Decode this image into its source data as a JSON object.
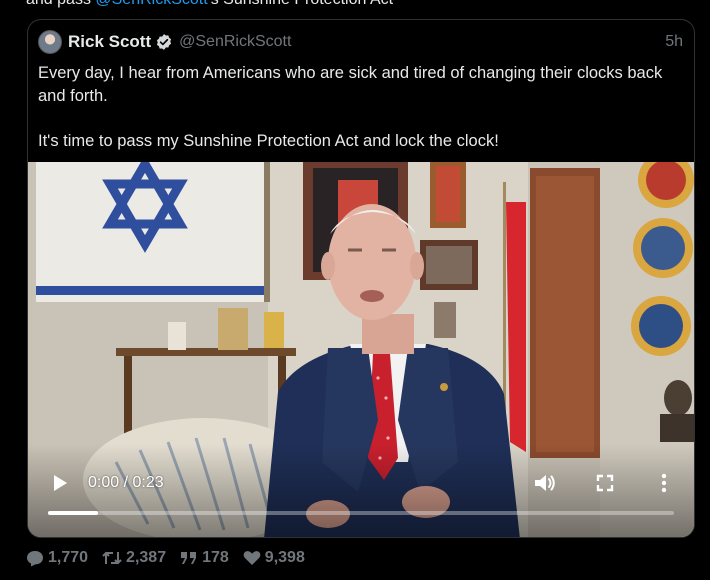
{
  "context_line": {
    "prefix": "and pass ",
    "mention": "@SenRickScott",
    "suffix": "'s Sunshine Protection Act"
  },
  "quoted_tweet": {
    "author_name": "Rick Scott",
    "handle": "@SenRickScott",
    "time": "5h",
    "verified_icon": "verified-badge-icon",
    "text_paragraphs": [
      "Every day, I hear from Americans who are sick and tired of changing their clocks back and forth.",
      "It's time to pass my Sunshine Protection Act and lock the clock!"
    ]
  },
  "video_player": {
    "time_display": "0:00 / 0:23",
    "progress_fraction": 0.08,
    "icons": [
      "play-icon",
      "volume-icon",
      "fullscreen-icon",
      "more-options-icon"
    ]
  },
  "metrics": {
    "replies": "1,770",
    "retweets": "2,387",
    "quotes": "178",
    "likes": "9,398"
  },
  "colors": {
    "background": "#000000",
    "text": "#e7e9ea",
    "muted": "#71767b",
    "accent": "#1d9bf0",
    "border": "#2f3336"
  }
}
